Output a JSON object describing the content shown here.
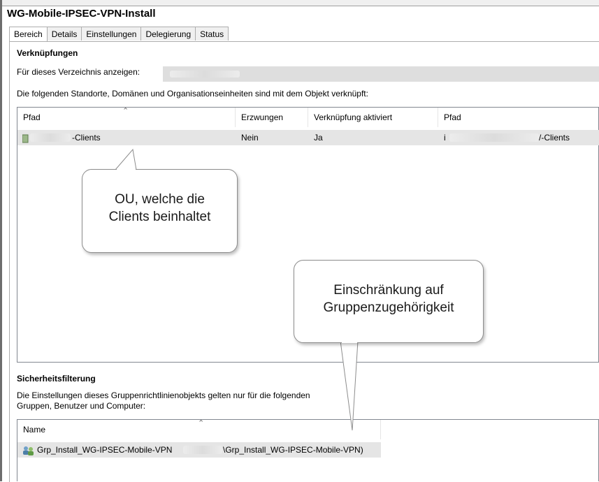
{
  "window": {
    "title": "WG-Mobile-IPSEC-VPN-Install"
  },
  "tabs": [
    {
      "label": "Bereich",
      "active": true
    },
    {
      "label": "Details"
    },
    {
      "label": "Einstellungen"
    },
    {
      "label": "Delegierung"
    },
    {
      "label": "Status"
    }
  ],
  "links": {
    "heading": "Verknüpfungen",
    "scope_label": "Für dieses Verzeichnis anzeigen:",
    "description": "Die folgenden Standorte, Domänen und Organisationseinheiten sind mit dem Objekt verknüpft:",
    "columns": [
      "Pfad",
      "Erzwungen",
      "Verknüpfung aktiviert",
      "Pfad"
    ],
    "rows": [
      {
        "name_suffix": "-Clients",
        "enforced": "Nein",
        "enabled": "Ja",
        "path_prefix": "i",
        "path_suffix": "/-Clients"
      }
    ]
  },
  "security": {
    "heading": "Sicherheitsfilterung",
    "description_line1": "Die Einstellungen dieses Gruppenrichtlinienobjekts gelten nur für die folgenden",
    "description_line2": "Gruppen, Benutzer und Computer:",
    "column": "Name",
    "rows": [
      {
        "name_prefix": "Grp_Install_WG-IPSEC-Mobile-VPN",
        "name_suffix": "\\Grp_Install_WG-IPSEC-Mobile-VPN)"
      }
    ]
  },
  "annotations": {
    "ou_line1": "OU, welche die",
    "ou_line2": "Clients beinhaltet",
    "group_line1": "Einschränkung auf",
    "group_line2": "Gruppenzugehörigkeit"
  }
}
